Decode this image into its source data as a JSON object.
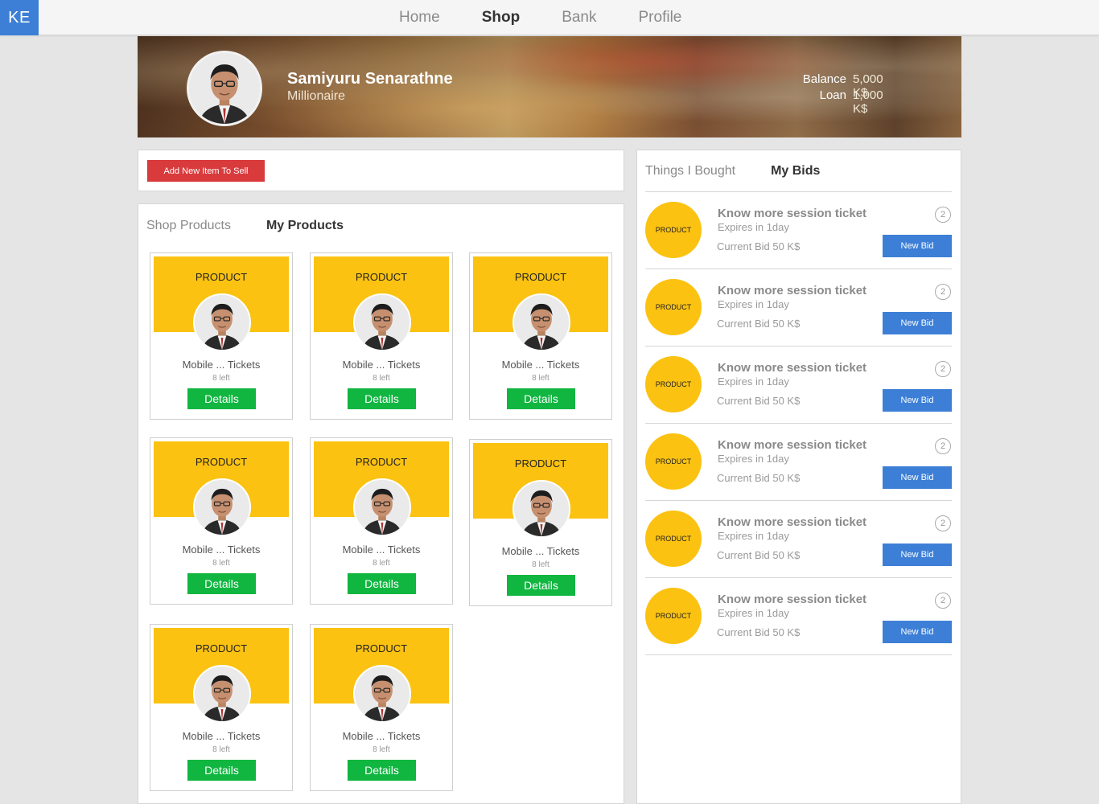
{
  "app": {
    "logo": "KE"
  },
  "nav": {
    "tabs": [
      {
        "label": "Home",
        "active": false
      },
      {
        "label": "Shop",
        "active": true
      },
      {
        "label": "Bank",
        "active": false
      },
      {
        "label": "Profile",
        "active": false
      }
    ]
  },
  "profile": {
    "name": "Samiyuru Senarathne",
    "rank": "Millionaire",
    "balance_label": "Balance",
    "balance_value": "5,000 K$",
    "loan_label": "Loan",
    "loan_value": "1,000 K$"
  },
  "shop": {
    "add_button": "Add New Item To Sell",
    "tabs": [
      {
        "label": "Shop Products",
        "active": false
      },
      {
        "label": "My Products",
        "active": true
      }
    ],
    "products": [
      {
        "banner": "PRODUCT",
        "title": "Mobile ... Tickets",
        "stock": "8 left",
        "button": "Details"
      },
      {
        "banner": "PRODUCT",
        "title": "Mobile ... Tickets",
        "stock": "8 left",
        "button": "Details"
      },
      {
        "banner": "PRODUCT",
        "title": "Mobile ... Tickets",
        "stock": "8 left",
        "button": "Details"
      },
      {
        "banner": "PRODUCT",
        "title": "Mobile ... Tickets",
        "stock": "8 left",
        "button": "Details"
      },
      {
        "banner": "PRODUCT",
        "title": "Mobile ... Tickets",
        "stock": "8 left",
        "button": "Details"
      },
      {
        "banner": "PRODUCT",
        "title": "Mobile ... Tickets",
        "stock": "8 left",
        "button": "Details"
      },
      {
        "banner": "PRODUCT",
        "title": "Mobile ... Tickets",
        "stock": "8 left",
        "button": "Details"
      },
      {
        "banner": "PRODUCT",
        "title": "Mobile ... Tickets",
        "stock": "8 left",
        "button": "Details"
      }
    ]
  },
  "bids": {
    "tabs": [
      {
        "label": "Things I Bought",
        "active": false
      },
      {
        "label": "My Bids",
        "active": true
      }
    ],
    "items": [
      {
        "thumb": "PRODUCT",
        "title": "Know more session ticket",
        "expires": "Expires in 1day",
        "current": "Current Bid 50 K$",
        "count": "2",
        "button": "New Bid"
      },
      {
        "thumb": "PRODUCT",
        "title": "Know more session ticket",
        "expires": "Expires in 1day",
        "current": "Current Bid 50 K$",
        "count": "2",
        "button": "New Bid"
      },
      {
        "thumb": "PRODUCT",
        "title": "Know more session ticket",
        "expires": "Expires in 1day",
        "current": "Current Bid 50 K$",
        "count": "2",
        "button": "New Bid"
      },
      {
        "thumb": "PRODUCT",
        "title": "Know more session ticket",
        "expires": "Expires in 1day",
        "current": "Current Bid 50 K$",
        "count": "2",
        "button": "New Bid"
      },
      {
        "thumb": "PRODUCT",
        "title": "Know more session ticket",
        "expires": "Expires in 1day",
        "current": "Current Bid 50 K$",
        "count": "2",
        "button": "New Bid"
      },
      {
        "thumb": "PRODUCT",
        "title": "Know more session ticket",
        "expires": "Expires in 1day",
        "current": "Current Bid 50 K$",
        "count": "2",
        "button": "New Bid"
      }
    ]
  }
}
